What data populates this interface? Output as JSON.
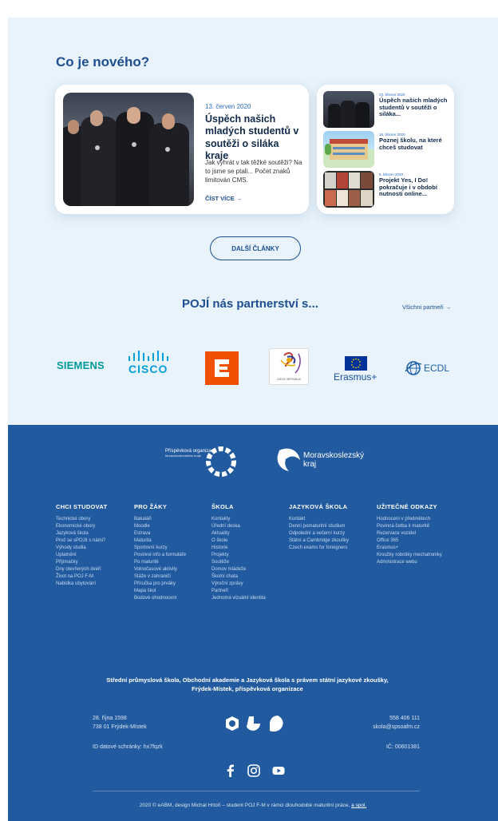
{
  "news": {
    "heading": "Co je nového?",
    "featured": {
      "date": "13. červen 2020",
      "title": "Úspěch našich mladých studentů v soutěži o siláka kraje",
      "excerpt": "Jak vyhrát v tak těžké soutěži? Na to jsme se ptali... Počet znaků limitován CMS.",
      "more": "ČÍST VÍCE →"
    },
    "items": [
      {
        "date": "23. březen 2020",
        "title": "Úspěch našich mladých studentů v soutěži o siláka..."
      },
      {
        "date": "16. březen 2020",
        "title": "Poznej školu, na které chceš studovat"
      },
      {
        "date": "6. březen 2020",
        "title": "Projekt Yes, I Do! pokračuje i v období nutnosti online..."
      }
    ],
    "more_button": "DALŠÍ ČLÁNKY"
  },
  "partners": {
    "heading": "POJÍ nás partnerství s...",
    "all_link": "Všichni partneři →",
    "logos": {
      "siemens": "SIEMENS",
      "cisco": "CISCO",
      "czech": "CZECH REPUBLIC",
      "erasmus": "Erasmus+",
      "ecdl": "ECDL"
    }
  },
  "footer": {
    "org_logo_text": "Příspěvková organizace",
    "org_logo_sub": "Moravskoslezského kraje",
    "kraj_line1": "Moravskoslezský",
    "kraj_line2": "kraj",
    "columns": [
      {
        "title": "CHCI STUDOVAT",
        "links": [
          "Technické obory",
          "Ekonomické obory",
          "Jazyková škola",
          "Proč se sPOJit s námi?",
          "Výhody studia",
          "Uplatnění",
          "Přijímačky",
          "Dny otevřených dveří",
          "Život na POJ F-M",
          "Nabídka ubytování"
        ]
      },
      {
        "title": "PRO ŽÁKY",
        "links": [
          "Bakaláři",
          "Moodle",
          "Estrava",
          "Maturita",
          "Sportovní kurzy",
          "Povinné info a formuláře",
          "Po maturitě",
          "Volnočasové aktivity",
          "Stáže v zahraničí",
          "Příručka pro prváky",
          "Mapa škol",
          "Bodové ohodnocení"
        ]
      },
      {
        "title": "ŠKOLA",
        "links": [
          "Kontakty",
          "Úřední deska",
          "Aktuality",
          "O škole",
          "Historie",
          "Projekty",
          "Soutěže",
          "Domov mládeže",
          "Školní chata",
          "Výroční zprávy",
          "Partneři",
          "Jednotná vizuální identita"
        ]
      },
      {
        "title": "JAZYKOVÁ ŠKOLA",
        "links": [
          "Kontakt",
          "Denní pomaturitní studium",
          "Odpolední a večerní kurzy",
          "Státní a Cambridge zkoušky",
          "Czech exams for foreigners"
        ]
      },
      {
        "title": "UŽITEČNÉ ODKAZY",
        "links": [
          "Hodnocení v předmětech",
          "Povinná četba k maturitě",
          "Rezervace vozidel",
          "Office 365",
          "Erasmus+",
          "Kroužky robotiky mechatroniky",
          "Administrace webu"
        ]
      }
    ],
    "org_name_line1": "Střední průmyslová škola, Obchodní akademie a Jazyková škola s právem státní jazykové zkoušky,",
    "org_name_line2": "Frýdek-Místek, příspěvková organizace",
    "address_line1": "28. října 1598",
    "address_line2": "738 01 Frýdek-Místek",
    "data_box": "ID datové schránky: hx7fqzk",
    "phone": "558 406 111",
    "email": "skola@spsoafm.cz",
    "ic": "IČ: 00601381",
    "copyright_text": "2020 © eABM, design Michal Hrtoň – student POJ F-M v rámci dlouhodobé maturitní práce,",
    "copyright_link": "a spol."
  },
  "colors": {
    "light_bg": "#e8f3fb",
    "footer_bg": "#215a9e",
    "primary": "#1d4f91",
    "accent": "#2a69c0",
    "cez_orange": "#f24f00",
    "siemens_teal": "#009999",
    "cisco_blue": "#049fd9"
  },
  "icons": [
    "facebook-icon",
    "instagram-icon",
    "youtube-icon",
    "arrow-right-icon"
  ]
}
